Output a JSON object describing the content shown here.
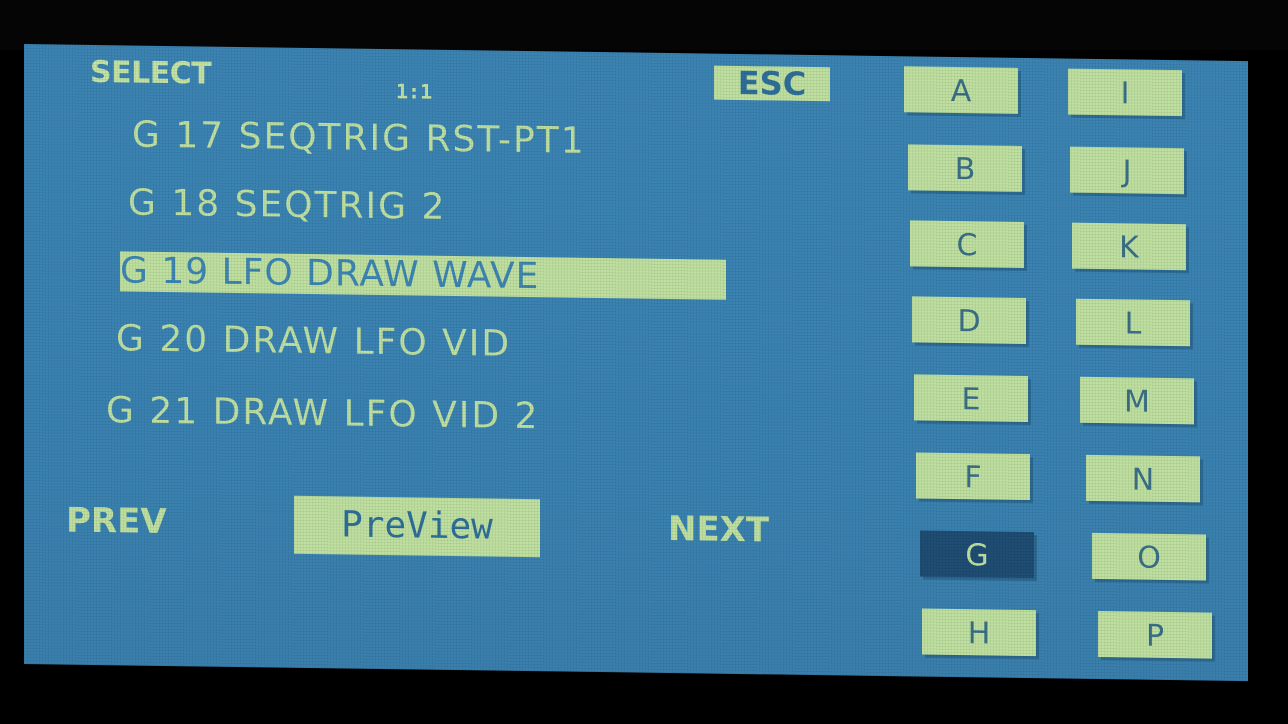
{
  "header": {
    "title": "SELECT",
    "page_indicator": "1:1",
    "esc_label": "ESC"
  },
  "entries": [
    {
      "text": "G 17 SEQTRIG RST-PT1",
      "selected": false
    },
    {
      "text": "G 18 SEQTRIG 2",
      "selected": false
    },
    {
      "text": "G 19 LFO DRAW WAVE  ",
      "selected": true
    },
    {
      "text": "G 20 DRAW LFO VID",
      "selected": false
    },
    {
      "text": "G 21 DRAW LFO VID 2",
      "selected": false
    }
  ],
  "nav": {
    "prev_label": "PREV",
    "preview_label": "PreView",
    "next_label": "NEXT"
  },
  "banks": {
    "left": [
      "A",
      "B",
      "C",
      "D",
      "E",
      "F",
      "G",
      "H"
    ],
    "right": [
      "I",
      "J",
      "K",
      "L",
      "M",
      "N",
      "O",
      "P"
    ],
    "active": "G"
  },
  "colors": {
    "screen_bg": "#3a83b3",
    "foreground": "#bfe0a0",
    "active_bank_bg": "#1f4d74"
  }
}
